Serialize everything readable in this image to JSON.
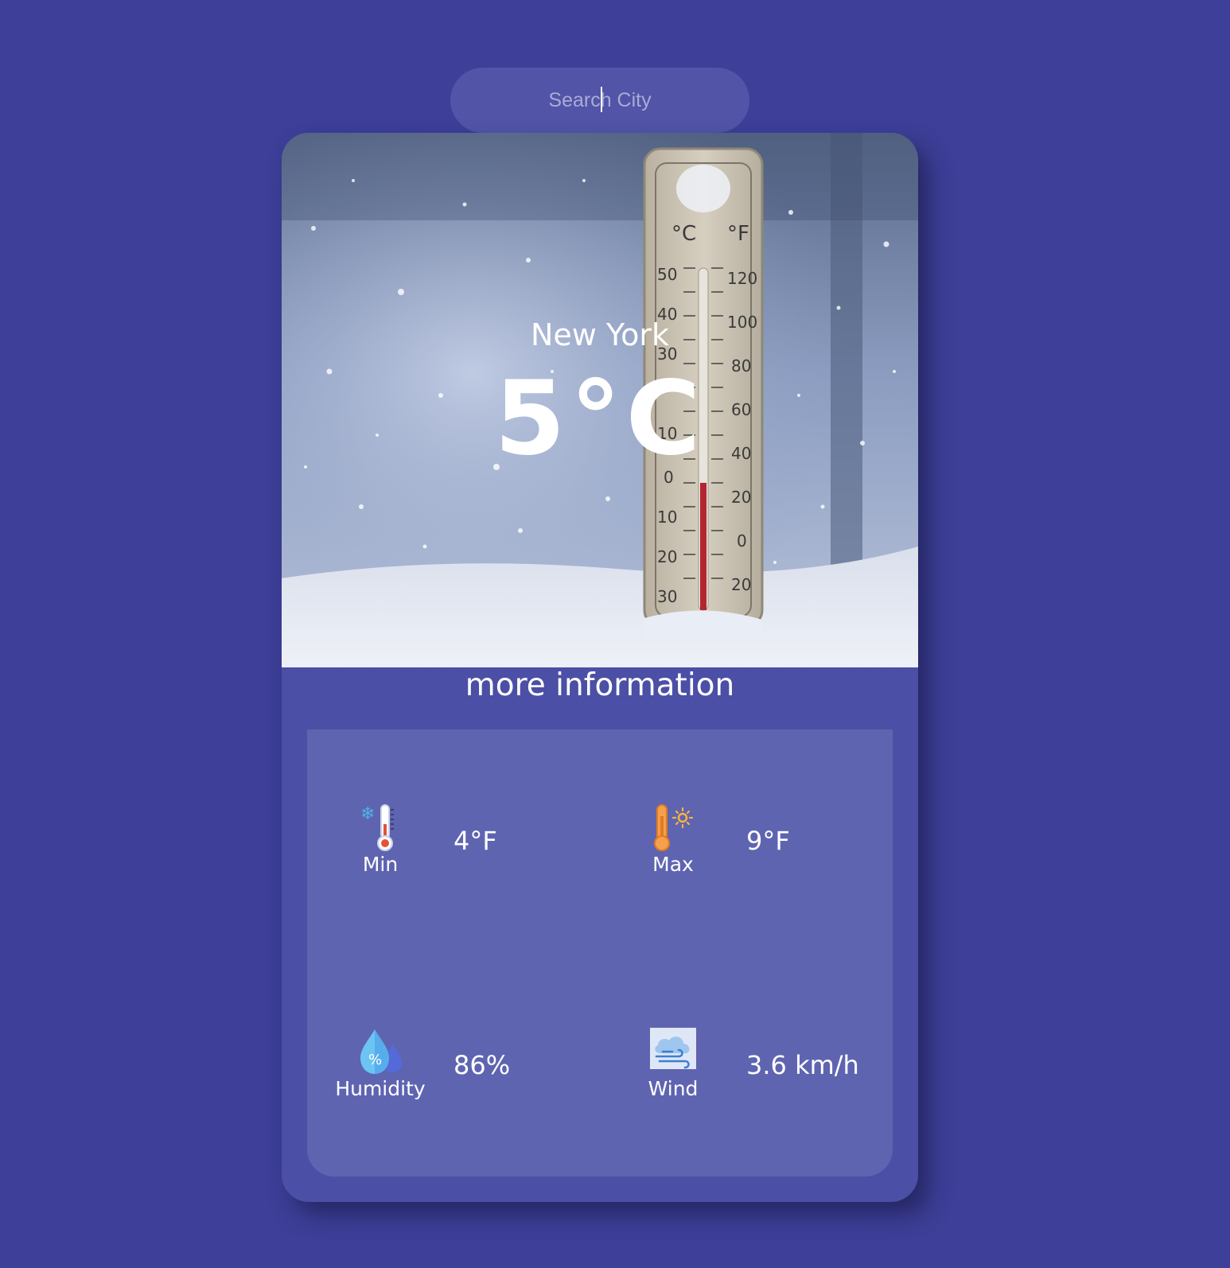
{
  "search": {
    "placeholder": "Search City"
  },
  "weather": {
    "city": "New York",
    "temperature": "5°C"
  },
  "details": {
    "heading": "more information",
    "min": {
      "label": "Min",
      "value": "4°F",
      "icon": "cold-thermometer-icon"
    },
    "max": {
      "label": "Max",
      "value": "9°F",
      "icon": "hot-thermometer-icon"
    },
    "humidity": {
      "label": "Humidity",
      "value": "86%",
      "icon": "humidity-drop-icon"
    },
    "wind": {
      "label": "Wind",
      "value": "3.6 km/h",
      "icon": "wind-cloud-icon"
    }
  },
  "colors": {
    "background": "#3d3f98",
    "card": "#4b4fa6",
    "panel": "#5f64b1",
    "search": "#5254a8"
  }
}
